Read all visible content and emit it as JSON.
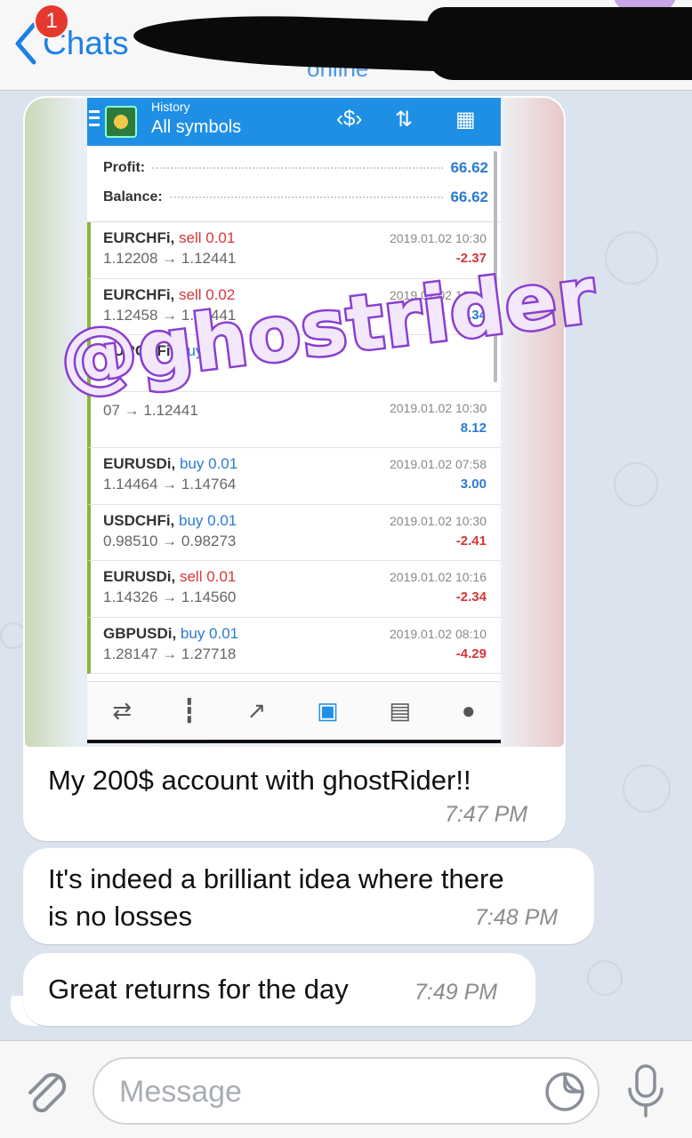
{
  "header": {
    "back_label": "Chats",
    "unread_count": "1",
    "subtitle": "online"
  },
  "screenshot": {
    "title_small": "History",
    "title_main": "All symbols",
    "summary": [
      {
        "label": "Profit:",
        "value": "66.62"
      },
      {
        "label": "Balance:",
        "value": "66.62"
      }
    ],
    "trades": [
      {
        "symbol": "EURCHFi,",
        "side": "sell 0.01",
        "type": "sell",
        "prices": "1.12208 → 1.12441",
        "date": "2019.01.02 10:30",
        "pl": "-2.37",
        "pl_type": "neg"
      },
      {
        "symbol": "EURCHFi,",
        "side": "sell 0.02",
        "type": "sell",
        "prices": "1.12458 → 1.12441",
        "date": "2019.01.02 10:30",
        "pl": "0.34",
        "pl_type": "pos"
      },
      {
        "symbol": "EURCHFi,",
        "side": "buy",
        "type": "buy",
        "prices": "",
        "date": "",
        "pl": "",
        "pl_type": "neg"
      },
      {
        "symbol": "",
        "side": "",
        "type": "buy",
        "prices": "07 → 1.12441",
        "date": "2019.01.02 10:30",
        "pl": "8.12",
        "pl_type": "pos"
      },
      {
        "symbol": "EURUSDi,",
        "side": "buy 0.01",
        "type": "buy",
        "prices": "1.14464 → 1.14764",
        "date": "2019.01.02 07:58",
        "pl": "3.00",
        "pl_type": "pos"
      },
      {
        "symbol": "USDCHFi,",
        "side": "buy 0.01",
        "type": "buy",
        "prices": "0.98510 → 0.98273",
        "date": "2019.01.02 10:30",
        "pl": "-2.41",
        "pl_type": "neg"
      },
      {
        "symbol": "EURUSDi,",
        "side": "sell 0.01",
        "type": "sell",
        "prices": "1.14326 → 1.14560",
        "date": "2019.01.02 10:16",
        "pl": "-2.34",
        "pl_type": "neg"
      },
      {
        "symbol": "GBPUSDi,",
        "side": "buy 0.01",
        "type": "buy",
        "prices": "1.28147 → 1.27718",
        "date": "2019.01.02 08:10",
        "pl": "-4.29",
        "pl_type": "neg"
      }
    ],
    "watermark": "@ghostrider"
  },
  "messages": [
    {
      "text": "My 200$ account with ghostRider!!",
      "time": "7:47 PM"
    },
    {
      "text_line1": "It's indeed a brilliant idea where there",
      "text_line2": "is no losses",
      "time": "7:48 PM"
    },
    {
      "text": "Great returns for the day",
      "time": "7:49 PM"
    }
  ],
  "input": {
    "placeholder": "Message"
  },
  "colors": {
    "accent": "#1d80e5",
    "badge": "#e5392d",
    "chat_bg": "#dbe3ee",
    "watermark": "#8a3fd1"
  }
}
